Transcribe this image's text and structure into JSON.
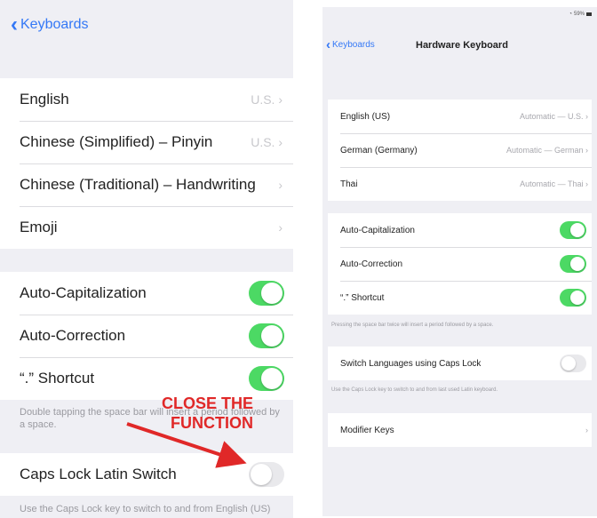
{
  "left": {
    "back_label": "Keyboards",
    "keyboards": [
      {
        "label": "English",
        "detail": "U.S."
      },
      {
        "label": "Chinese (Simplified) – Pinyin",
        "detail": "U.S."
      },
      {
        "label": "Chinese (Traditional) – Handwriting",
        "detail": ""
      },
      {
        "label": "Emoji",
        "detail": ""
      }
    ],
    "toggles": [
      {
        "label": "Auto-Capitalization",
        "state": "on"
      },
      {
        "label": "Auto-Correction",
        "state": "on"
      },
      {
        "label": "“.” Shortcut",
        "state": "on"
      }
    ],
    "shortcut_footer": "Double tapping the space bar will insert a period followed by a space.",
    "caps_lock": {
      "label": "Caps Lock Latin Switch",
      "state": "off"
    },
    "caps_lock_footer": "Use the Caps Lock key to switch to and from English (US)",
    "annotation_line1": "CLOSE THE",
    "annotation_line2": "FUNCTION",
    "annotation_color": "#e02828"
  },
  "right": {
    "status": "59%",
    "back_label": "Keyboards",
    "title": "Hardware Keyboard",
    "keyboards": [
      {
        "label": "English (US)",
        "detail": "Automatic — U.S."
      },
      {
        "label": "German (Germany)",
        "detail": "Automatic — German"
      },
      {
        "label": "Thai",
        "detail": "Automatic — Thai"
      }
    ],
    "toggles": [
      {
        "label": "Auto-Capitalization",
        "state": "on"
      },
      {
        "label": "Auto-Correction",
        "state": "on"
      },
      {
        "label": "“.” Shortcut",
        "state": "on"
      }
    ],
    "shortcut_footer": "Pressing the space bar twice will insert a period followed by a space.",
    "caps_lock": {
      "label": "Switch Languages using Caps Lock",
      "state": "off"
    },
    "caps_lock_footer": "Use the Caps Lock key to switch to and from last used Latin keyboard.",
    "modifier_keys": "Modifier Keys"
  },
  "colors": {
    "accent": "#3478f6",
    "toggle_on": "#4cd964",
    "background": "#efeff4"
  }
}
